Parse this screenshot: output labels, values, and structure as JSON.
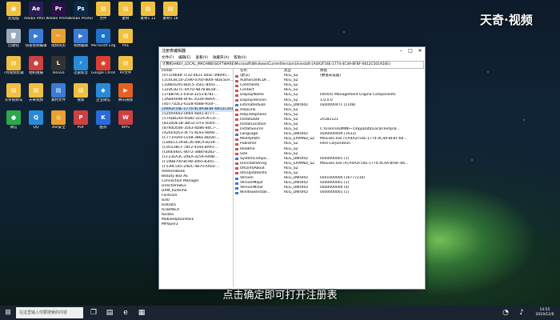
{
  "watermark": "天奇·视频",
  "caption": "点击确定即可打开注册表",
  "desktop_icons": [
    {
      "label": "此电脑",
      "color": "#f0c040",
      "glyph": "▣",
      "icon": "computer-icon"
    },
    {
      "label": "Adobe After Effects CC",
      "color": "#2b1c58",
      "glyph": "Ae",
      "icon": "ae-icon"
    },
    {
      "label": "Adobe Premiere P...",
      "color": "#2d0f4a",
      "glyph": "Pr",
      "icon": "pr-icon"
    },
    {
      "label": "Adobe Photosh...",
      "color": "#0b2a4a",
      "glyph": "Ps",
      "icon": "ps-icon"
    },
    {
      "label": "文件",
      "color": "#f0c040",
      "glyph": "▤",
      "icon": "folder-icon"
    },
    {
      "label": "素材",
      "color": "#f0c040",
      "glyph": "▤",
      "icon": "folder-icon"
    },
    {
      "label": "素材1.12",
      "color": "#f0c040",
      "glyph": "▤",
      "icon": "folder-icon"
    },
    {
      "label": "素材1.18",
      "color": "#f0c040",
      "glyph": "▤",
      "icon": "folder-icon"
    },
    {
      "label": "回收站",
      "color": "#9ab",
      "glyph": "🗑",
      "icon": "recycle-bin-icon"
    },
    {
      "label": "快速视频编辑",
      "color": "#3a7bd5",
      "glyph": "▶",
      "icon": "video-editor-icon"
    },
    {
      "label": "视频快剪",
      "color": "#e8a030",
      "glyph": "✂",
      "icon": "cut-icon"
    },
    {
      "label": "视频编辑",
      "color": "#3a7bd5",
      "glyph": "▶",
      "icon": "video-icon"
    },
    {
      "label": "Microsoft Edge",
      "color": "#1e73c8",
      "glyph": "e",
      "icon": "edge-icon"
    },
    {
      "label": "PRE",
      "color": "#f0c040",
      "glyph": "▤",
      "icon": "folder-icon"
    },
    {
      "label": "7月视频剪辑",
      "color": "#f0c040",
      "glyph": "▤",
      "icon": "folder-icon"
    },
    {
      "label": "相机拍摄",
      "color": "#d04040",
      "glyph": "●",
      "icon": "camera-icon"
    },
    {
      "label": "lenovo",
      "color": "#333",
      "glyph": "L",
      "icon": "lenovo-icon"
    },
    {
      "label": "迅雷影音",
      "color": "#2a8ad8",
      "glyph": "⚡",
      "icon": "player-icon"
    },
    {
      "label": "Google Chrome",
      "color": "#d84030",
      "glyph": "◉",
      "icon": "chrome-icon"
    },
    {
      "label": "PR文件",
      "color": "#f0c040",
      "glyph": "▤",
      "icon": "folder-icon"
    },
    {
      "label": "头条视频号",
      "color": "#f0c040",
      "glyph": "▤",
      "icon": "folder-icon"
    },
    {
      "label": "天奇视频",
      "color": "#f0c040",
      "glyph": "▤",
      "icon": "folder-icon"
    },
    {
      "label": "素材文件",
      "color": "#3a7bd5",
      "glyph": "▤",
      "icon": "folder-icon"
    },
    {
      "label": "搜索",
      "color": "#f0c040",
      "glyph": "▤",
      "icon": "folder-icon"
    },
    {
      "label": "企业微信",
      "color": "#2a8ad8",
      "glyph": "◆",
      "icon": "wecom-icon"
    },
    {
      "label": "腾讯视频",
      "color": "#e86020",
      "glyph": "▶",
      "icon": "tencent-video-icon"
    },
    {
      "label": "微信",
      "color": "#2aa84a",
      "glyph": "●",
      "icon": "wechat-icon"
    },
    {
      "label": "QQ",
      "color": "#2a8ad8",
      "glyph": "Q",
      "icon": "qq-icon"
    },
    {
      "label": "360安全",
      "color": "#e8a030",
      "glyph": "◎",
      "icon": "security-icon"
    },
    {
      "label": "PDF",
      "color": "#d04040",
      "glyph": "P",
      "icon": "pdf-icon"
    },
    {
      "label": "酷狗",
      "color": "#2a6ad8",
      "glyph": "K",
      "icon": "kugou-icon"
    },
    {
      "label": "WPS",
      "color": "#d04040",
      "glyph": "W",
      "icon": "wps-icon"
    }
  ],
  "regedit": {
    "title": "注册表编辑器",
    "menu": [
      "文件(F)",
      "编辑(E)",
      "查看(V)",
      "收藏夹(A)",
      "帮助(H)"
    ],
    "address": "计算机\\HKEY_LOCAL_MACHINE\\SOFTWARE\\Microsoft\\Windows\\CurrentVersion\\Uninstall\\{A4A2F54E-1774-4C4A-BFBF-6612C501A50E}",
    "tree": [
      "Install",
      "{071c9b48-7c32-4621-a0ac-3f8095...",
      "{1C6C8C50-2590-4760-800F-8DE5E9...",
      "{1DBE6291-BDC5-35EC-8441-...",
      "{32DC827C-4A7D-4B78-BE58-...",
      "{37B8F9C1-03FB-3253-8781-...",
      "{3AB4A696-8F6C-4330-A8AA-...",
      "{40771DE2-6328-40B8-950F-...",
      "{A4A2F54E-1774-4C4A-BFBF-6612C501A...",
      "{520AA602-0064-4B41-8777-...",
      "{57ADB244-958D-321A-AFC0-...",
      "{8220DE1B-3BCD-37FE-8505-...",
      "{8760D506-3563-4D86-80C7-...",
      "{A20E4D51-4F75-4E93-A8A8-...",
      "{C771F6A4-CE08-386E-BDD0-...",
      "{C84ECC39-BC26-48CA-B239-...",
      "{C95538CF-7BF2-4344-BA91-...",
      "{CB0E66EC-8072-38B0-B2B2-...",
      "{CF23EA3C-29EA-3259-A498-...",
      "{F10BB700-BF98-3065-B305-...",
      "{F539C545-24DC-4B70-AA02-...",
      "AddressBook",
      "Beauty Box AE",
      "Connection Manager",
      "DirectDrawEx",
      "DXM_Runtime",
      "Fontcore",
      "IE40",
      "IE4Data",
      "IE5BAKEX",
      "IEData",
      "MobileOptionPack",
      "MPlayer2"
    ],
    "columns": [
      "名称",
      "类型",
      "数据"
    ],
    "rows": [
      {
        "name": "(默认)",
        "type": "REG_SZ",
        "data": "(数值未设置)",
        "dw": false
      },
      {
        "name": "AuthorizedCDF...",
        "type": "REG_SZ",
        "data": "",
        "dw": false
      },
      {
        "name": "Comments",
        "type": "REG_SZ",
        "data": "",
        "dw": false
      },
      {
        "name": "Contact",
        "type": "REG_SZ",
        "data": "",
        "dw": false
      },
      {
        "name": "DisplayName",
        "type": "REG_SZ",
        "data": "Intel(R) Management Engine Components",
        "dw": false
      },
      {
        "name": "DisplayVersion",
        "type": "REG_SZ",
        "data": "1.0.0.0",
        "dw": false
      },
      {
        "name": "EstimatedSize",
        "type": "REG_DWORD",
        "data": "0x0000047c (1148)",
        "dw": true
      },
      {
        "name": "HelpLink",
        "type": "REG_SZ",
        "data": "",
        "dw": false
      },
      {
        "name": "HelpTelephone",
        "type": "REG_SZ",
        "data": "",
        "dw": false
      },
      {
        "name": "InstallDate",
        "type": "REG_SZ",
        "data": "20181121",
        "dw": false
      },
      {
        "name": "InstallLocation",
        "type": "REG_SZ",
        "data": "",
        "dw": false
      },
      {
        "name": "InstallSource",
        "type": "REG_SZ",
        "data": "C:\\Users\\ADMINI~1\\AppData\\Local\\Temp\\IF...",
        "dw": false
      },
      {
        "name": "Language",
        "type": "REG_DWORD",
        "data": "0x00000409 (1033)",
        "dw": true
      },
      {
        "name": "ModifyPath",
        "type": "REG_EXPAND_SZ",
        "data": "MsiExec.exe /I{A4A2F54E-1774-4C4A-BFBF-66...",
        "dw": false
      },
      {
        "name": "Publisher",
        "type": "REG_SZ",
        "data": "Intel Corporation",
        "dw": false
      },
      {
        "name": "Readme",
        "type": "REG_SZ",
        "data": "",
        "dw": false
      },
      {
        "name": "Size",
        "type": "REG_SZ",
        "data": "",
        "dw": false
      },
      {
        "name": "SystemCompo...",
        "type": "REG_DWORD",
        "data": "0x00000001 (1)",
        "dw": true
      },
      {
        "name": "UninstallString",
        "type": "REG_EXPAND_SZ",
        "data": "MsiExec.exe /X{A4A2F54E-1774-4C4A-BFBF-66...",
        "dw": false
      },
      {
        "name": "URLInfoAbout",
        "type": "REG_SZ",
        "data": "",
        "dw": false
      },
      {
        "name": "URLUpdateInfo",
        "type": "REG_SZ",
        "data": "",
        "dw": false
      },
      {
        "name": "Version",
        "type": "REG_DWORD",
        "data": "0x01000000 (16777216)",
        "dw": true
      },
      {
        "name": "VersionMajor",
        "type": "REG_DWORD",
        "data": "0x00000001 (1)",
        "dw": true
      },
      {
        "name": "VersionMinor",
        "type": "REG_DWORD",
        "data": "0x00000000 (0)",
        "dw": true
      },
      {
        "name": "WindowsInstall...",
        "type": "REG_DWORD",
        "data": "0x00000001 (1)",
        "dw": true
      }
    ]
  },
  "taskbar": {
    "search_placeholder": "在这里输入你要搜索的内容",
    "time": "14:55",
    "date": "2019/12/6"
  }
}
